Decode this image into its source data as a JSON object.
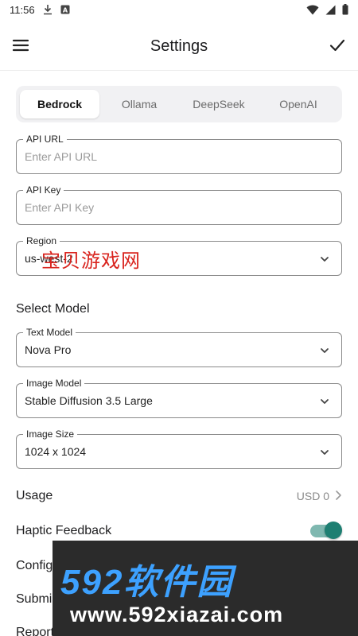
{
  "status_bar": {
    "time": "11:56",
    "icons": [
      "download-icon",
      "notification-a-icon",
      "wifi-icon",
      "cellular-icon",
      "battery-icon"
    ]
  },
  "app_bar": {
    "title": "Settings",
    "menu_icon": "menu-icon",
    "confirm_icon": "check-icon"
  },
  "provider_tabs": {
    "items": [
      {
        "label": "Bedrock",
        "selected": true
      },
      {
        "label": "Ollama",
        "selected": false
      },
      {
        "label": "DeepSeek",
        "selected": false
      },
      {
        "label": "OpenAI",
        "selected": false
      }
    ]
  },
  "fields": {
    "api_url": {
      "label": "API URL",
      "value": "",
      "placeholder": "Enter API URL"
    },
    "api_key": {
      "label": "API Key",
      "value": "",
      "placeholder": "Enter API Key"
    },
    "region": {
      "label": "Region",
      "value": "us-west-2"
    }
  },
  "select_model": {
    "title": "Select Model",
    "text_model": {
      "label": "Text Model",
      "value": "Nova Pro"
    },
    "image_model": {
      "label": "Image Model",
      "value": "Stable Diffusion 3.5 Large"
    },
    "image_size": {
      "label": "Image Size",
      "value": "1024 x 1024"
    }
  },
  "rows": {
    "usage": {
      "label": "Usage",
      "value": "USD 0"
    },
    "haptic": {
      "label": "Haptic Feedback",
      "enabled": true
    },
    "config": {
      "label": "Config"
    },
    "submit": {
      "label": "Submi"
    },
    "report": {
      "label": "Report"
    }
  },
  "watermark": {
    "overlay_text": "宝贝游戏网",
    "banner_big": "592软件园",
    "banner_url": "www.592xiazai.com"
  },
  "colors": {
    "accent": "#1e7f72",
    "toggle_track": "#7fb8b0",
    "field_border": "#8a8a8a",
    "tab_bg": "#f1f1f3"
  }
}
